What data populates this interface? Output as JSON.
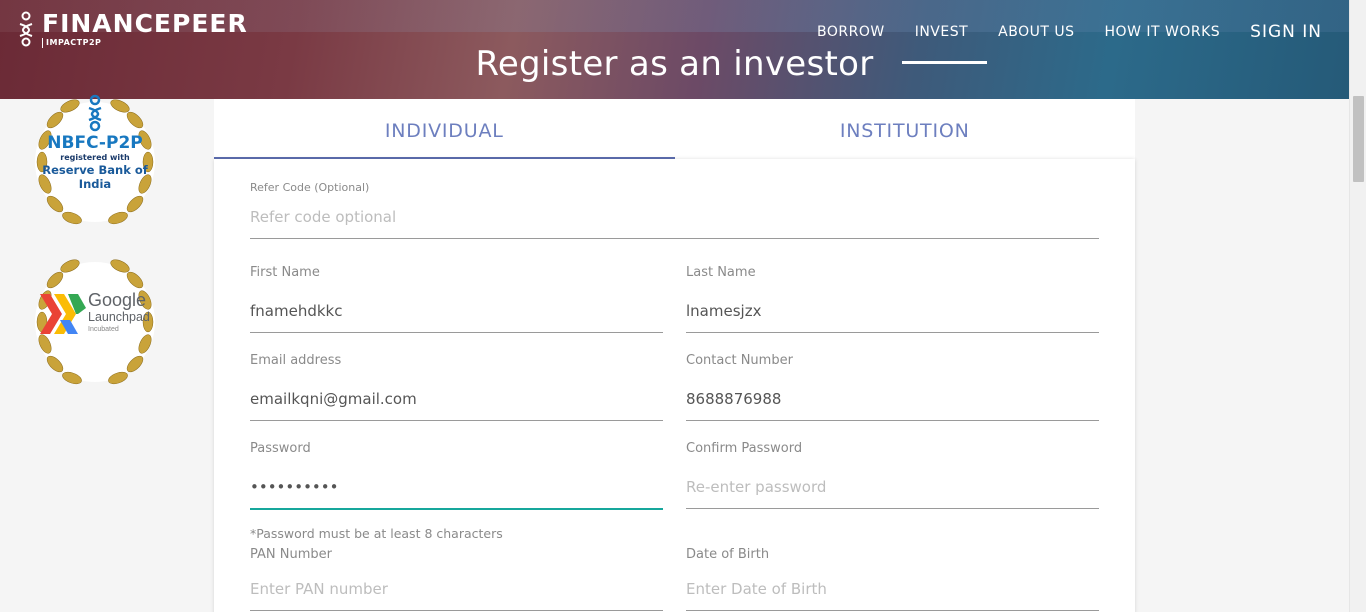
{
  "brand": {
    "name": "FINANCEPEER",
    "tagline": "IMPACTP2P"
  },
  "nav": {
    "items": [
      "BORROW",
      "INVEST",
      "ABOUT US",
      "HOW IT WORKS"
    ],
    "signin": "SIGN IN"
  },
  "hero": {
    "title": "Register as an investor"
  },
  "badges": {
    "nbfc": {
      "title": "NBFC-P2P",
      "line1": "registered with",
      "line2": "Reserve Bank of",
      "line3": "India"
    },
    "google": {
      "name": "Google",
      "line1": "Launchpad",
      "line2": "Incubated"
    }
  },
  "tabs": [
    "INDIVIDUAL",
    "INSTITUTION"
  ],
  "form": {
    "refer": {
      "label": "Refer Code (Optional)",
      "value": "",
      "placeholder": "Refer code optional"
    },
    "first_name": {
      "label": "First Name",
      "value": "fnamehdkkc",
      "placeholder": ""
    },
    "last_name": {
      "label": "Last Name",
      "value": "lnamesjzx",
      "placeholder": ""
    },
    "email": {
      "label": "Email address",
      "value": "emailkqni@gmail.com",
      "placeholder": ""
    },
    "contact": {
      "label": "Contact Number",
      "value": "8688876988",
      "placeholder": ""
    },
    "password": {
      "label": "Password",
      "value": "xxxxxxxxxx",
      "placeholder": ""
    },
    "confirm_password": {
      "label": "Confirm Password",
      "value": "",
      "placeholder": "Re-enter password"
    },
    "password_hint": "*Password must be at least 8 characters",
    "pan": {
      "label": "PAN Number",
      "value": "",
      "placeholder": "Enter PAN number"
    },
    "dob": {
      "label": "Date of Birth",
      "value": "",
      "placeholder": "Enter Date of Birth"
    }
  },
  "colors": {
    "accent": "#6d7fbf",
    "active_input": "#17a79c"
  }
}
